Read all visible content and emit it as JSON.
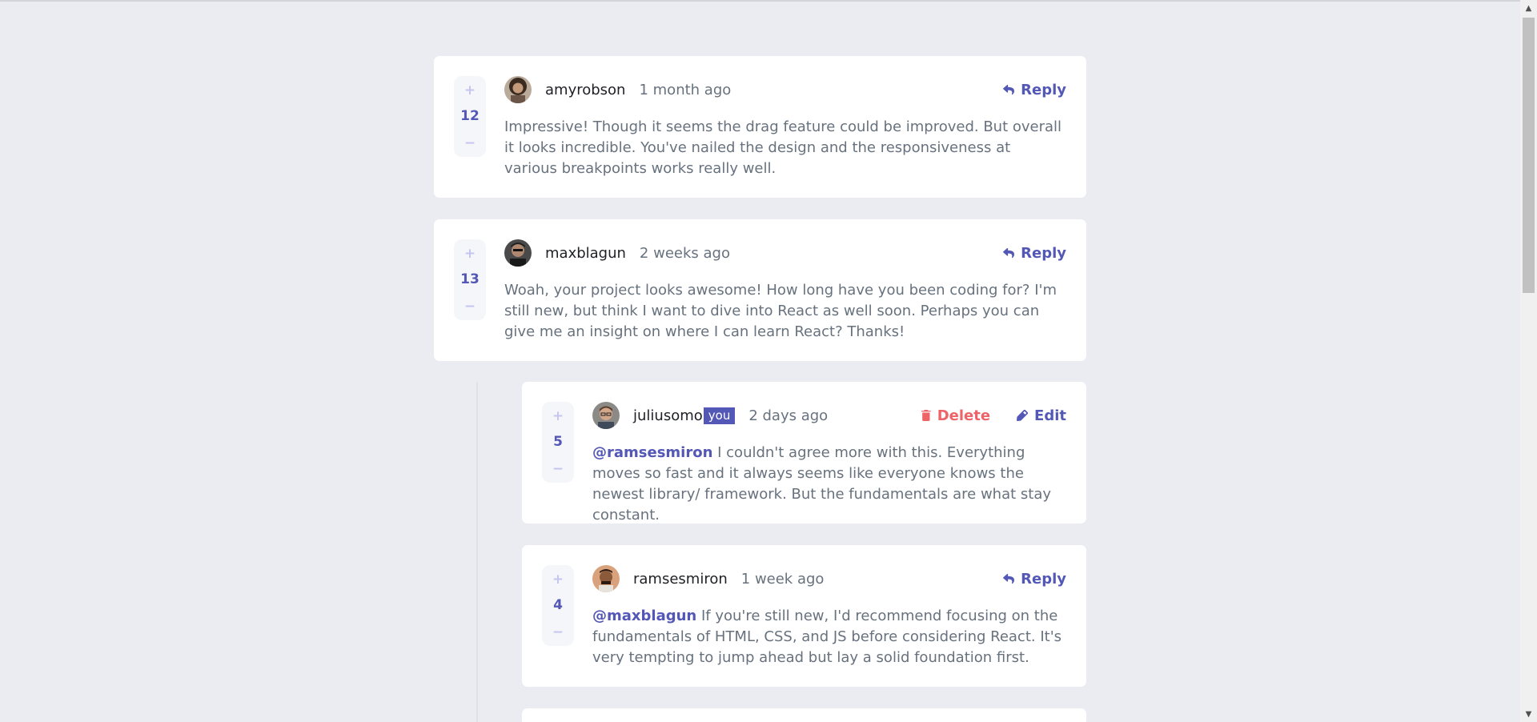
{
  "comments": [
    {
      "username": "amyrobson",
      "created": "1 month ago",
      "score": "12",
      "action": "Reply",
      "text": "Impressive! Though it seems the drag feature could be improved. But overall it looks incredible. You've nailed the design and the responsiveness at various breakpoints works really well."
    },
    {
      "username": "maxblagun",
      "created": "2 weeks ago",
      "score": "13",
      "action": "Reply",
      "text": "Woah, your project looks awesome! How long have you been coding for? I'm still new, but think I want to dive into React as well soon. Perhaps you can give me an insight on where I can learn React? Thanks!"
    }
  ],
  "replies": [
    {
      "username": "juliusomo",
      "you_badge": "you",
      "created": "2 days ago",
      "score": "5",
      "delete_label": "Delete",
      "edit_label": "Edit",
      "mention": "@ramsesmiron",
      "text": " I couldn't agree more with this. Everything moves so fast and it always seems like everyone knows the newest library/ framework. But the fundamentals are what stay constant."
    },
    {
      "username": "ramsesmiron",
      "created": "1 week ago",
      "score": "4",
      "action": "Reply",
      "mention": "@maxblagun",
      "text": " If you're still new, I'd recommend focusing on the fundamentals of HTML, CSS, and JS before considering React. It's very tempting to jump ahead but lay a solid foundation first."
    }
  ],
  "vote_symbols": {
    "plus": "+",
    "minus": "−"
  },
  "scrollbar": {
    "up": "▲",
    "down": "▼"
  },
  "colors": {
    "background": "#eaecf1",
    "card": "#ffffff",
    "accent": "#5357b6",
    "accent_light": "#c5c6ef",
    "danger": "#ed6368",
    "text": "#67727e",
    "username": "#1f2026"
  },
  "icons": [
    "reply-icon",
    "delete-icon",
    "edit-icon"
  ]
}
